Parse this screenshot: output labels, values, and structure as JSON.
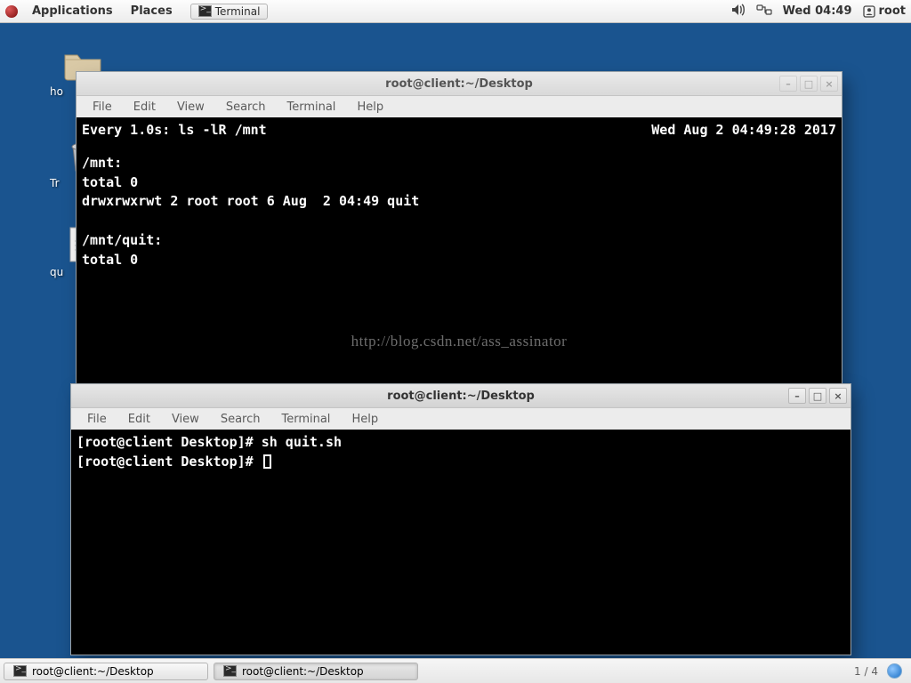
{
  "panel": {
    "applications": "Applications",
    "places": "Places",
    "task": "Terminal",
    "clock": "Wed 04:49",
    "user": "root"
  },
  "desktop": {
    "home_label": "ho",
    "trash_label": "Tr",
    "quit_label": "qu"
  },
  "win1": {
    "title": "root@client:~/Desktop",
    "menus": [
      "File",
      "Edit",
      "View",
      "Search",
      "Terminal",
      "Help"
    ],
    "header_left": "Every 1.0s: ls -lR /mnt",
    "header_right": "Wed Aug  2 04:49:28 2017",
    "body": "/mnt:\ntotal 0\ndrwxrwxrwt 2 root root 6 Aug  2 04:49 quit\n\n/mnt/quit:\ntotal 0",
    "watermark": "http://blog.csdn.net/ass_assinator"
  },
  "win2": {
    "title": "root@client:~/Desktop",
    "menus": [
      "File",
      "Edit",
      "View",
      "Search",
      "Terminal",
      "Help"
    ],
    "line1_prompt": "[root@client Desktop]# ",
    "line1_cmd": "sh quit.sh",
    "line2_prompt": "[root@client Desktop]# "
  },
  "taskbar": {
    "items": [
      {
        "label": "root@client:~/Desktop"
      },
      {
        "label": "root@client:~/Desktop"
      }
    ],
    "workspace": "1 / 4"
  }
}
